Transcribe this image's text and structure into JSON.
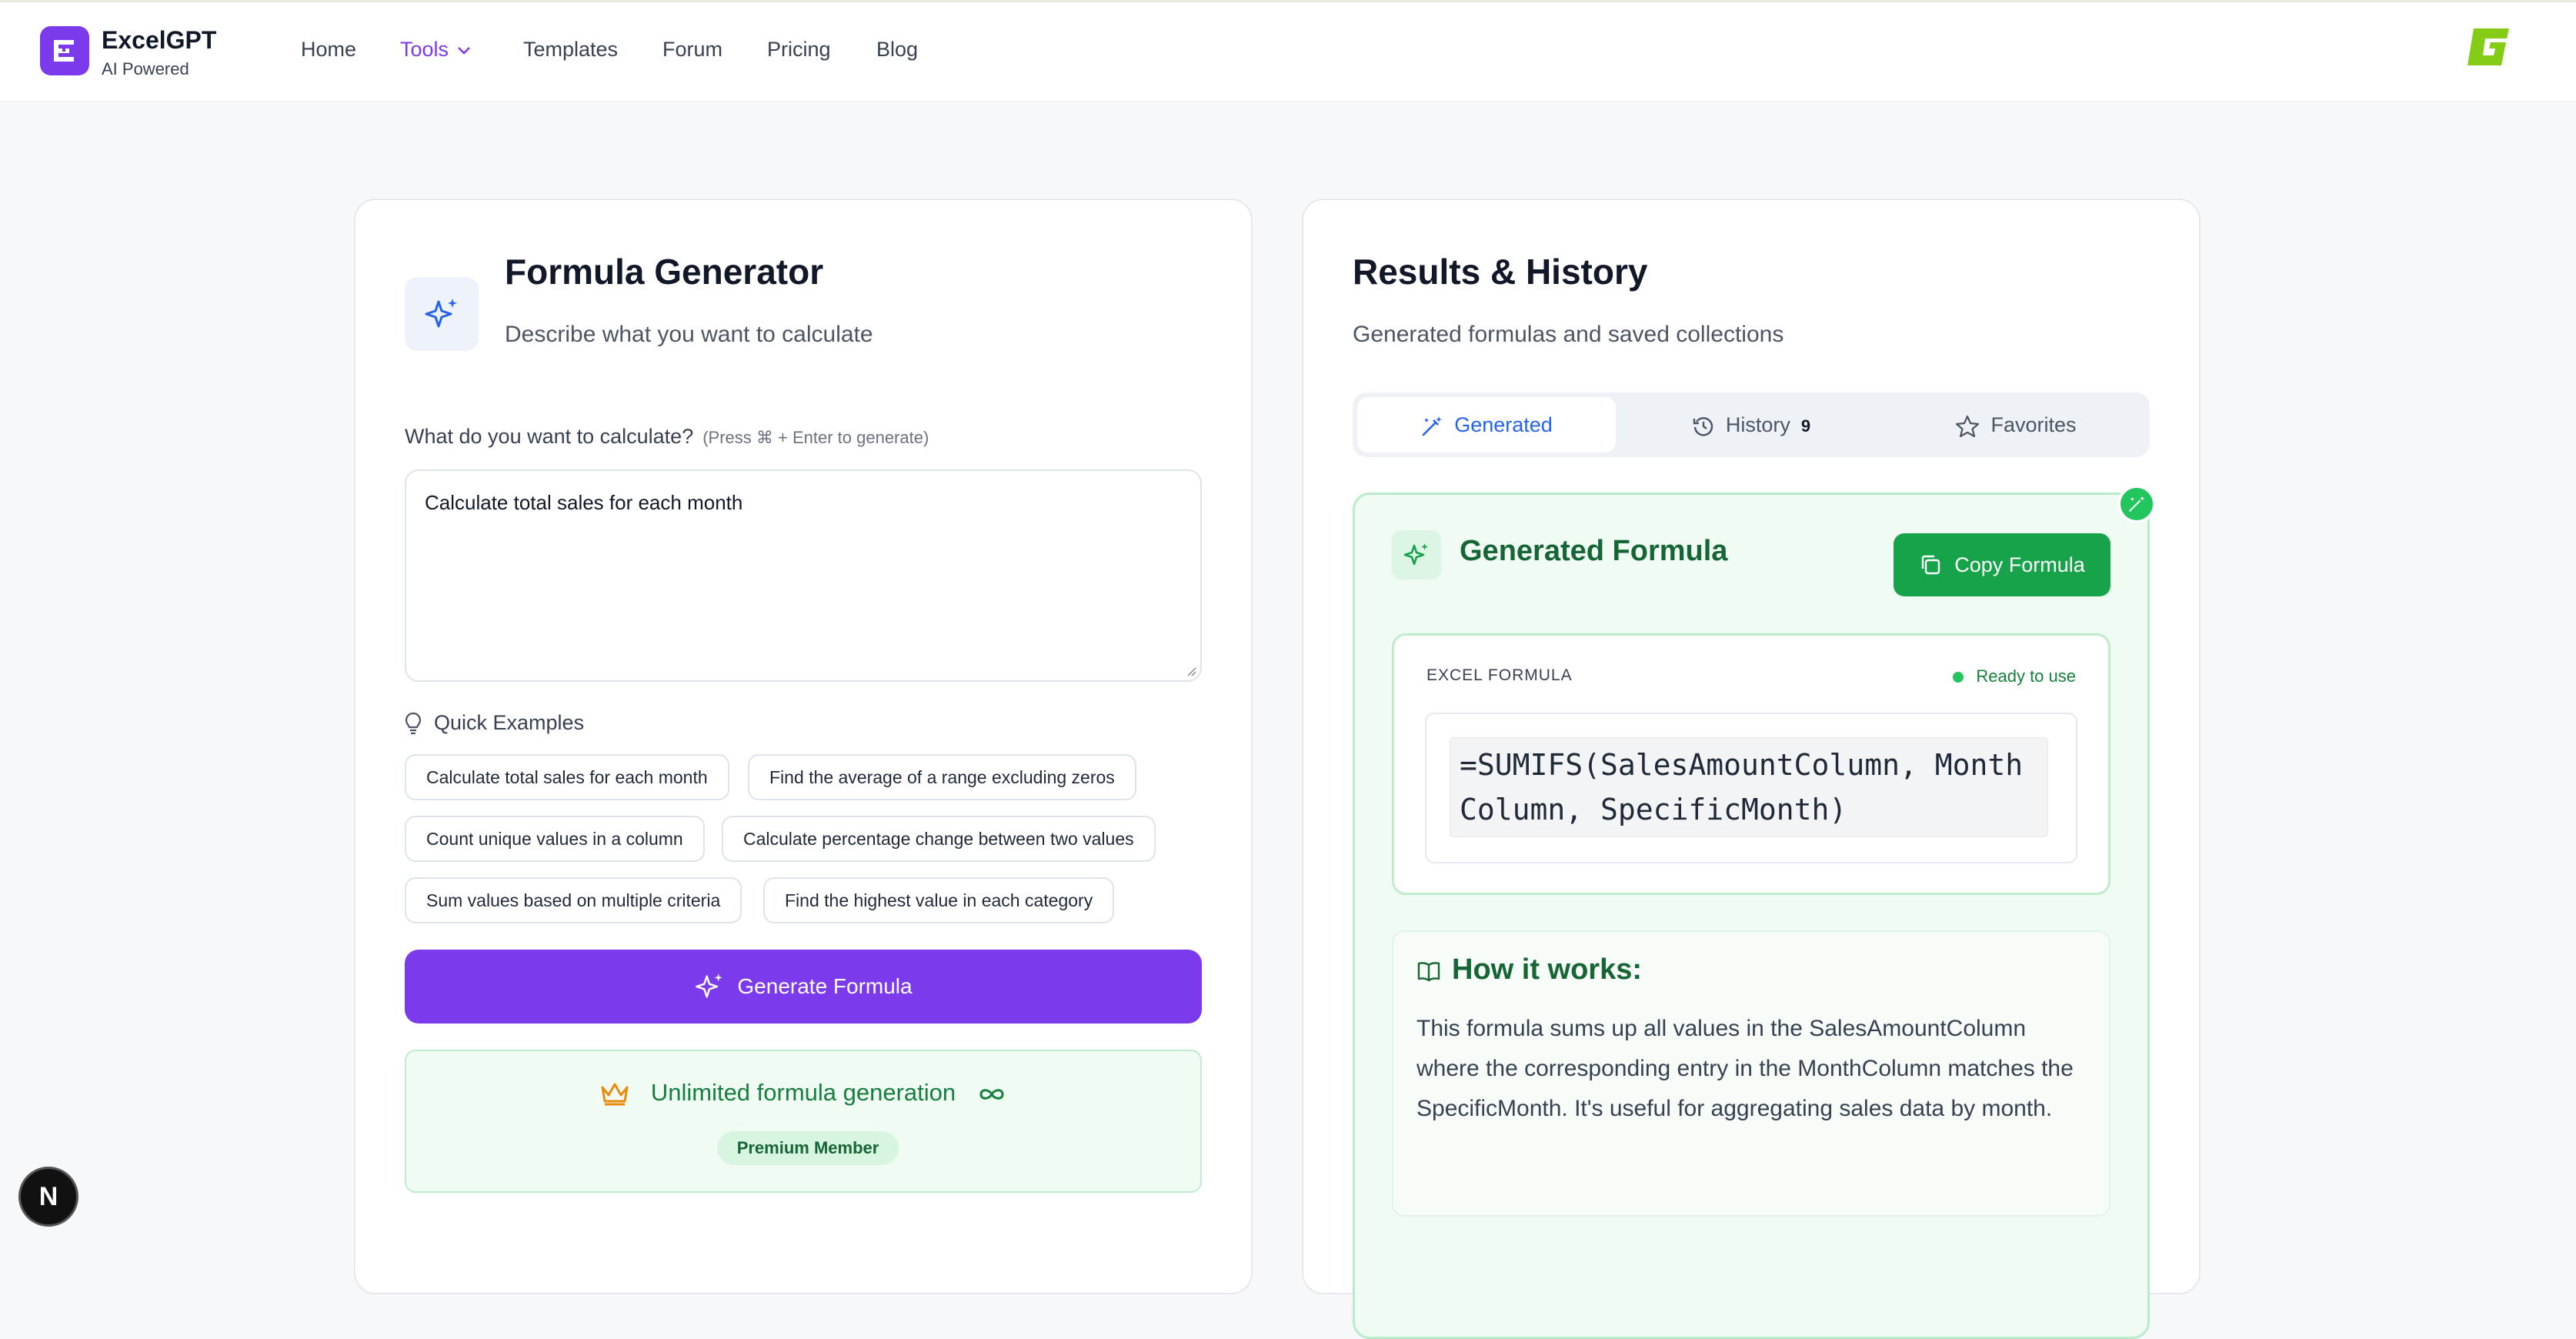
{
  "brand": {
    "name": "ExcelGPT",
    "subtitle": "AI Powered"
  },
  "nav": {
    "home": "Home",
    "tools": "Tools",
    "templates": "Templates",
    "forum": "Forum",
    "pricing": "Pricing",
    "blog": "Blog"
  },
  "generator": {
    "title": "Formula Generator",
    "subtitle": "Describe what you want to calculate",
    "field_label": "What do you want to calculate?",
    "field_hint": "(Press ⌘ + Enter to generate)",
    "input_value": "Calculate total sales for each month",
    "quick_examples_title": "Quick Examples",
    "examples": [
      "Calculate total sales for each month",
      "Find the average of a range excluding zeros",
      "Count unique values in a column",
      "Calculate percentage change between two values",
      "Sum values based on multiple criteria",
      "Find the highest value in each category"
    ],
    "generate_button": "Generate Formula",
    "premium_text": "Unlimited formula generation",
    "premium_badge": "Premium Member"
  },
  "results": {
    "title": "Results & History",
    "subtitle": "Generated formulas and saved collections",
    "tabs": {
      "generated": "Generated",
      "history": "History",
      "history_count": "9",
      "favorites": "Favorites"
    },
    "generated_title": "Generated Formula",
    "copy_button": "Copy Formula",
    "formula_label": "EXCEL FORMULA",
    "status": "Ready to use",
    "formula": "=SUMIFS(SalesAmountColumn, MonthColumn, SpecificMonth)",
    "how_title": "How it works:",
    "how_text": "This formula sums up all values in the SalesAmountColumn where the corresponding entry in the MonthColumn matches the SpecificMonth. It's useful for aggregating sales data by month."
  },
  "dev_badge": "N",
  "colors": {
    "accent": "#7c3aed",
    "success": "#16a34a",
    "tab_active": "#2563eb"
  }
}
